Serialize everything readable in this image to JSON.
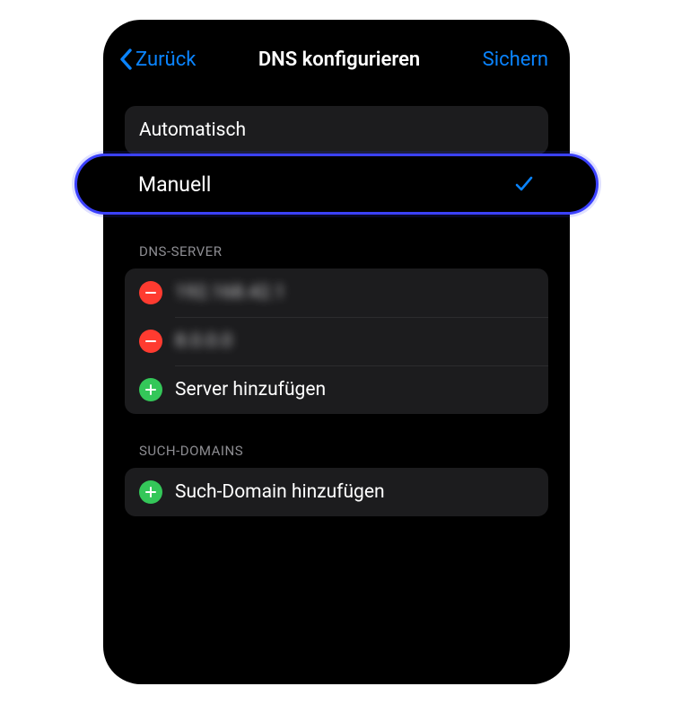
{
  "nav": {
    "back_label": "Zurück",
    "title": "DNS konfigurieren",
    "save_label": "Sichern"
  },
  "mode": {
    "auto_label": "Automatisch",
    "manual_label": "Manuell"
  },
  "dns": {
    "header": "DNS-Server",
    "servers": [
      "192.168.42.1",
      "8.0.0.0"
    ],
    "add_label": "Server hinzufügen"
  },
  "searchDomains": {
    "header": "Such-Domains",
    "add_label": "Such-Domain hinzufügen"
  }
}
